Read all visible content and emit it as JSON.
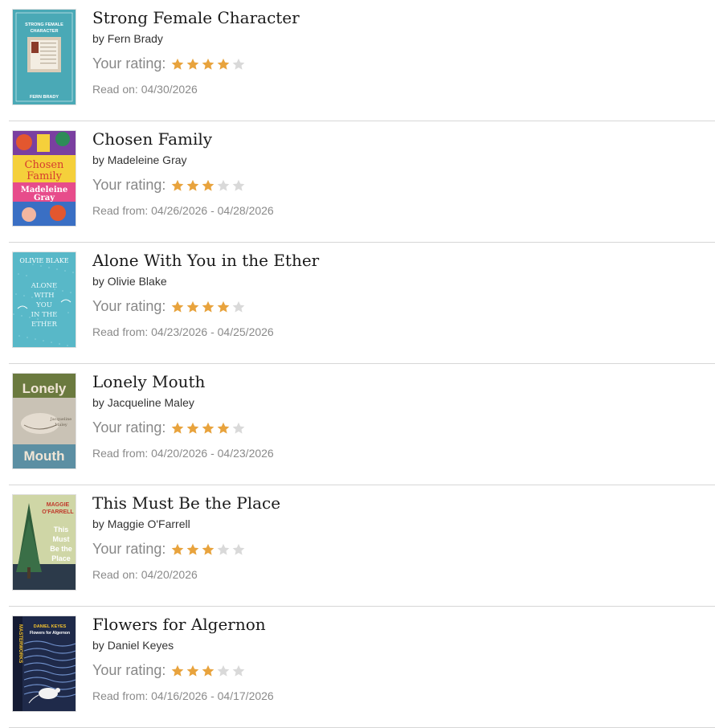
{
  "labels": {
    "author_prefix": "by",
    "rating_label": "Your rating:"
  },
  "colors": {
    "star_filled": "#e8a33d",
    "star_empty": "#d9d9d9"
  },
  "books": [
    {
      "title": "Strong Female Character",
      "author": "Fern Brady",
      "rating": 4,
      "max_rating": 5,
      "read_text": "Read on: 04/30/2026",
      "cover": {
        "style": "strong",
        "bg": "#4aa9b6",
        "lines": [
          "STRONG FEMALE",
          "CHARACTER"
        ],
        "bottom": "FERN BRADY"
      }
    },
    {
      "title": "Chosen Family",
      "author": "Madeleine Gray",
      "rating": 3,
      "max_rating": 5,
      "read_text": "Read from: 04/26/2026 - 04/28/2026",
      "cover": {
        "style": "chosen",
        "bg": "#f5d03b",
        "lines": [
          "Chosen",
          "Family"
        ],
        "bottom": "Madeleine Gray"
      }
    },
    {
      "title": "Alone With You in the Ether",
      "author": "Olivie Blake",
      "rating": 4,
      "max_rating": 5,
      "read_text": "Read from: 04/23/2026 - 04/25/2026",
      "cover": {
        "style": "ether",
        "bg": "#58b8c8",
        "lines": [
          "ALONE",
          "WITH",
          "YOU",
          "IN THE",
          "ETHER"
        ],
        "bottom": "OLIVIE BLAKE"
      }
    },
    {
      "title": "Lonely Mouth",
      "author": "Jacqueline Maley",
      "rating": 4,
      "max_rating": 5,
      "read_text": "Read from: 04/20/2026 - 04/23/2026",
      "cover": {
        "style": "lonely",
        "bg": "#6b7a3f",
        "lines": [
          "Lonely",
          "Mouth"
        ],
        "bottom": "Jacqueline Maley"
      }
    },
    {
      "title": "This Must Be the Place",
      "author": "Maggie O'Farrell",
      "rating": 3,
      "max_rating": 5,
      "read_text": "Read on: 04/20/2026",
      "cover": {
        "style": "place",
        "bg": "#cfd6a6",
        "lines": [
          "This",
          "Must",
          "Be the",
          "Place"
        ],
        "bottom": "MAGGIE O'FARRELL"
      }
    },
    {
      "title": "Flowers for Algernon",
      "author": "Daniel Keyes",
      "rating": 3,
      "max_rating": 5,
      "read_text": "Read from: 04/16/2026 - 04/17/2026",
      "cover": {
        "style": "flowers",
        "bg": "#1f2a4a",
        "lines": [
          "DANIEL KEYES",
          "Flowers for Algernon"
        ],
        "bottom": "MASTERWORKS"
      }
    }
  ]
}
